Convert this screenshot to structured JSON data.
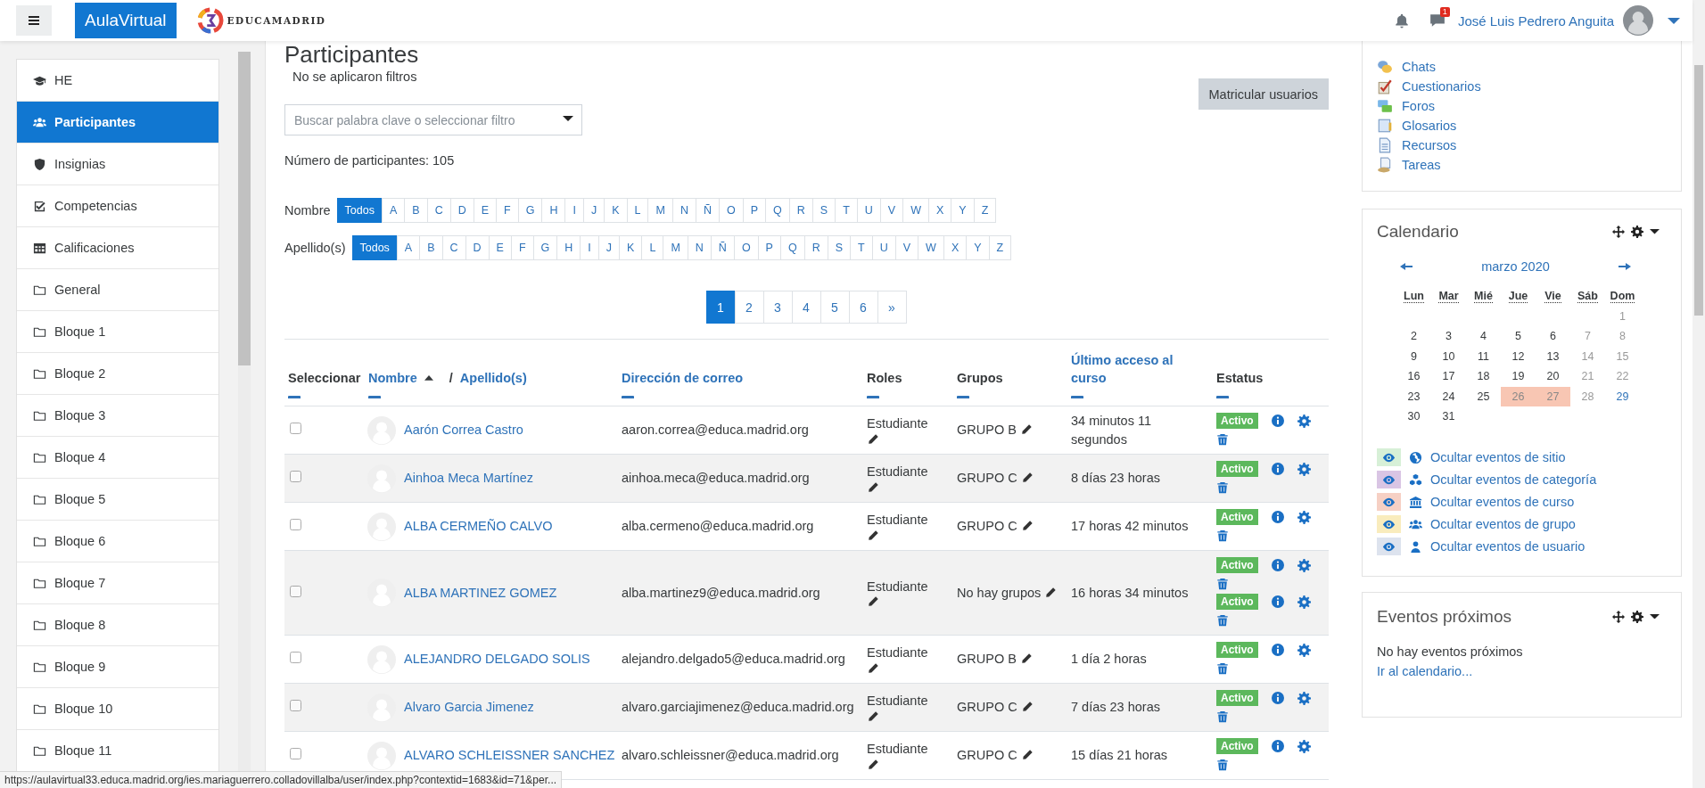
{
  "header": {
    "brand": "AulaVirtual",
    "logo_text": "EDUCAMADRID",
    "message_count": "1",
    "user_name": "José Luis Pedrero Anguita"
  },
  "nav": [
    {
      "label": "HE",
      "selected": false
    },
    {
      "label": "Participantes",
      "selected": true
    },
    {
      "label": "Insignias",
      "selected": false
    },
    {
      "label": "Competencias",
      "selected": false
    },
    {
      "label": "Calificaciones",
      "selected": false
    },
    {
      "label": "General",
      "selected": false
    },
    {
      "label": "Bloque 1",
      "selected": false
    },
    {
      "label": "Bloque 2",
      "selected": false
    },
    {
      "label": "Bloque 3",
      "selected": false
    },
    {
      "label": "Bloque 4",
      "selected": false
    },
    {
      "label": "Bloque 5",
      "selected": false
    },
    {
      "label": "Bloque 6",
      "selected": false
    },
    {
      "label": "Bloque 7",
      "selected": false
    },
    {
      "label": "Bloque 8",
      "selected": false
    },
    {
      "label": "Bloque 9",
      "selected": false
    },
    {
      "label": "Bloque 10",
      "selected": false
    },
    {
      "label": "Bloque 11",
      "selected": false
    }
  ],
  "page": {
    "title": "Participantes",
    "filters_note": "No se aplicaron filtros",
    "search": {
      "placeholder": "Buscar palabra clave o seleccionar filtro"
    },
    "enrol_button": "Matricular usuarios",
    "count": "Número de participantes: 105",
    "initial_filters": [
      {
        "label": "Nombre",
        "options": [
          {
            "text": "Todos",
            "selected": true
          },
          {
            "text": "A",
            "selected": false
          },
          {
            "text": "B",
            "selected": false
          },
          {
            "text": "C",
            "selected": false
          },
          {
            "text": "D",
            "selected": false
          },
          {
            "text": "E",
            "selected": false
          },
          {
            "text": "F",
            "selected": false
          },
          {
            "text": "G",
            "selected": false
          },
          {
            "text": "H",
            "selected": false
          },
          {
            "text": "I",
            "selected": false
          },
          {
            "text": "J",
            "selected": false
          },
          {
            "text": "K",
            "selected": false
          },
          {
            "text": "L",
            "selected": false
          },
          {
            "text": "M",
            "selected": false
          },
          {
            "text": "N",
            "selected": false
          },
          {
            "text": "Ñ",
            "selected": false
          },
          {
            "text": "O",
            "selected": false
          },
          {
            "text": "P",
            "selected": false
          },
          {
            "text": "Q",
            "selected": false
          },
          {
            "text": "R",
            "selected": false
          },
          {
            "text": "S",
            "selected": false
          },
          {
            "text": "T",
            "selected": false
          },
          {
            "text": "U",
            "selected": false
          },
          {
            "text": "V",
            "selected": false
          },
          {
            "text": "W",
            "selected": false
          },
          {
            "text": "X",
            "selected": false
          },
          {
            "text": "Y",
            "selected": false
          },
          {
            "text": "Z",
            "selected": false
          }
        ]
      },
      {
        "label": "Apellido(s)",
        "options": [
          {
            "text": "Todos",
            "selected": true
          },
          {
            "text": "A",
            "selected": false
          },
          {
            "text": "B",
            "selected": false
          },
          {
            "text": "C",
            "selected": false
          },
          {
            "text": "D",
            "selected": false
          },
          {
            "text": "E",
            "selected": false
          },
          {
            "text": "F",
            "selected": false
          },
          {
            "text": "G",
            "selected": false
          },
          {
            "text": "H",
            "selected": false
          },
          {
            "text": "I",
            "selected": false
          },
          {
            "text": "J",
            "selected": false
          },
          {
            "text": "K",
            "selected": false
          },
          {
            "text": "L",
            "selected": false
          },
          {
            "text": "M",
            "selected": false
          },
          {
            "text": "N",
            "selected": false
          },
          {
            "text": "Ñ",
            "selected": false
          },
          {
            "text": "O",
            "selected": false
          },
          {
            "text": "P",
            "selected": false
          },
          {
            "text": "Q",
            "selected": false
          },
          {
            "text": "R",
            "selected": false
          },
          {
            "text": "S",
            "selected": false
          },
          {
            "text": "T",
            "selected": false
          },
          {
            "text": "U",
            "selected": false
          },
          {
            "text": "V",
            "selected": false
          },
          {
            "text": "W",
            "selected": false
          },
          {
            "text": "X",
            "selected": false
          },
          {
            "text": "Y",
            "selected": false
          },
          {
            "text": "Z",
            "selected": false
          }
        ]
      }
    ],
    "pagination": [
      {
        "text": "1",
        "selected": true
      },
      {
        "text": "2",
        "selected": false
      },
      {
        "text": "3",
        "selected": false
      },
      {
        "text": "4",
        "selected": false
      },
      {
        "text": "5",
        "selected": false
      },
      {
        "text": "6",
        "selected": false
      },
      {
        "text": "»",
        "selected": false
      }
    ]
  },
  "table": {
    "columns": [
      {
        "label": "Seleccionar",
        "sortable": false
      },
      {
        "links": [
          {
            "label": "Nombre",
            "sorted": true
          },
          {
            "label": "Apellido(s)",
            "sorted": false
          }
        ],
        "separator": "/"
      },
      {
        "label": "Dirección de correo",
        "sortable": true
      },
      {
        "label": "Roles",
        "sortable": false
      },
      {
        "label": "Grupos",
        "sortable": false
      },
      {
        "label": "Último acceso al curso",
        "sortable": true
      },
      {
        "label": "Estatus",
        "sortable": false
      }
    ],
    "rows": [
      {
        "checked": false,
        "name": "Aarón Correa Castro",
        "email": "aaron.correa@educa.madrid.org",
        "role": "Estudiante",
        "group": "GRUPO B",
        "last_access": "34 minutos 11 segundos",
        "enrolments": [
          {
            "label": "Activo",
            "active": true
          }
        ]
      },
      {
        "checked": false,
        "name": "Ainhoa Meca Martínez",
        "email": "ainhoa.meca@educa.madrid.org",
        "role": "Estudiante",
        "group": "GRUPO C",
        "last_access": "8 días 23 horas",
        "enrolments": [
          {
            "label": "Activo",
            "active": true
          }
        ]
      },
      {
        "checked": false,
        "name": "ALBA CERMEÑO CALVO",
        "email": "alba.cermeno@educa.madrid.org",
        "role": "Estudiante",
        "group": "GRUPO C",
        "last_access": "17 horas 42 minutos",
        "enrolments": [
          {
            "label": "Activo",
            "active": true
          }
        ]
      },
      {
        "checked": false,
        "name": "ALBA MARTINEZ GOMEZ",
        "email": "alba.martinez9@educa.madrid.org",
        "role": "Estudiante",
        "group": "No hay grupos",
        "last_access": "16 horas 34 minutos",
        "enrolments": [
          {
            "label": "Activo",
            "active": true
          },
          {
            "label": "Activo",
            "active": true
          }
        ]
      },
      {
        "checked": false,
        "name": "ALEJANDRO DELGADO SOLIS",
        "email": "alejandro.delgado5@educa.madrid.org",
        "role": "Estudiante",
        "group": "GRUPO B",
        "last_access": "1 día 2 horas",
        "enrolments": [
          {
            "label": "Activo",
            "active": true
          }
        ]
      },
      {
        "checked": false,
        "name": "Alvaro Garcia Jimenez",
        "email": "alvaro.garciajimenez@educa.madrid.org",
        "role": "Estudiante",
        "group": "GRUPO C",
        "last_access": "7 días 23 horas",
        "enrolments": [
          {
            "label": "Activo",
            "active": true
          }
        ]
      },
      {
        "checked": false,
        "name": "ALVARO SCHLEISSNER SANCHEZ",
        "email": "alvaro.schleissner@educa.madrid.org",
        "role": "Estudiante",
        "group": "GRUPO C",
        "last_access": "15 días 21 horas",
        "enrolments": [
          {
            "label": "Activo",
            "active": true
          }
        ]
      }
    ]
  },
  "activities": [
    "Chats",
    "Cuestionarios",
    "Foros",
    "Glosarios",
    "Recursos",
    "Tareas"
  ],
  "calendar": {
    "title": "Calendario",
    "month": "marzo 2020",
    "weekdays": [
      "Lun",
      "Mar",
      "Mié",
      "Jue",
      "Vie",
      "Sáb",
      "Dom"
    ],
    "weeks": [
      [
        {
          "kind": "blank"
        },
        {
          "kind": "blank"
        },
        {
          "kind": "blank"
        },
        {
          "kind": "blank"
        },
        {
          "kind": "blank"
        },
        {
          "kind": "blank"
        },
        {
          "text": "1",
          "kind": "weekend"
        }
      ],
      [
        {
          "text": "2",
          "kind": "day"
        },
        {
          "text": "3",
          "kind": "day"
        },
        {
          "text": "4",
          "kind": "day"
        },
        {
          "text": "5",
          "kind": "day"
        },
        {
          "text": "6",
          "kind": "day"
        },
        {
          "text": "7",
          "kind": "weekend"
        },
        {
          "text": "8",
          "kind": "weekend"
        }
      ],
      [
        {
          "text": "9",
          "kind": "day"
        },
        {
          "text": "10",
          "kind": "day"
        },
        {
          "text": "11",
          "kind": "day"
        },
        {
          "text": "12",
          "kind": "day"
        },
        {
          "text": "13",
          "kind": "day"
        },
        {
          "text": "14",
          "kind": "weekend"
        },
        {
          "text": "15",
          "kind": "weekend"
        }
      ],
      [
        {
          "text": "16",
          "kind": "day"
        },
        {
          "text": "17",
          "kind": "day"
        },
        {
          "text": "18",
          "kind": "day"
        },
        {
          "text": "19",
          "kind": "day"
        },
        {
          "text": "20",
          "kind": "day"
        },
        {
          "text": "21",
          "kind": "weekend"
        },
        {
          "text": "22",
          "kind": "weekend"
        }
      ],
      [
        {
          "text": "23",
          "kind": "day"
        },
        {
          "text": "24",
          "kind": "day"
        },
        {
          "text": "25",
          "kind": "day"
        },
        {
          "text": "26",
          "kind": "event"
        },
        {
          "text": "27",
          "kind": "event"
        },
        {
          "text": "28",
          "kind": "weekend"
        },
        {
          "text": "29",
          "kind": "today"
        }
      ],
      [
        {
          "text": "30",
          "kind": "day"
        },
        {
          "text": "31",
          "kind": "day"
        },
        {
          "kind": "blank"
        },
        {
          "kind": "blank"
        },
        {
          "kind": "blank"
        },
        {
          "kind": "blank"
        },
        {
          "kind": "blank"
        }
      ]
    ],
    "filters": [
      {
        "label": "Ocultar eventos de sitio",
        "color": "#d7f0d7"
      },
      {
        "label": "Ocultar eventos de categoría",
        "color": "#d9c5e4"
      },
      {
        "label": "Ocultar eventos de curso",
        "color": "#f6d0c4"
      },
      {
        "label": "Ocultar eventos de grupo",
        "color": "#f9ecbd"
      },
      {
        "label": "Ocultar eventos de usuario",
        "color": "#dde3ee"
      }
    ]
  },
  "upcoming": {
    "title": "Eventos próximos",
    "empty_text": "No hay eventos próximos",
    "link": "Ir al calendario..."
  },
  "status_bar": {
    "url": "https://aulavirtual33.educa.madrid.org/ies.mariaguerrero.colladovillalba/user/index.php?contextid=1683&id=71&per..."
  }
}
